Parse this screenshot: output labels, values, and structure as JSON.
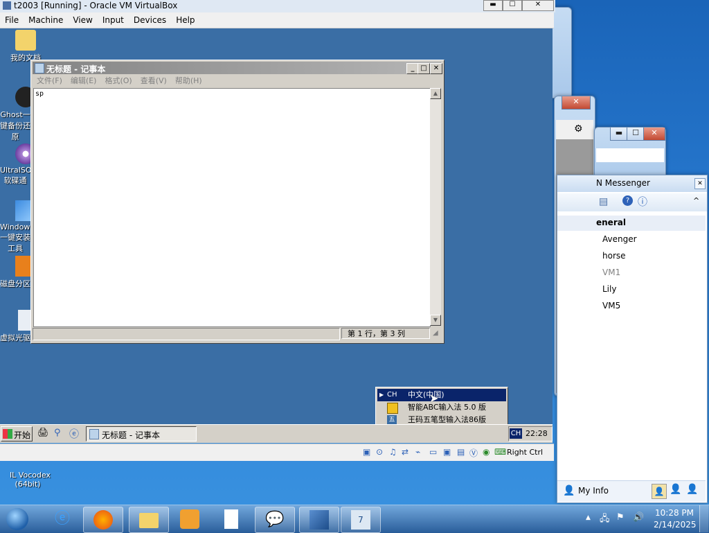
{
  "vbox": {
    "title": "t2003 [Running] - Oracle VM VirtualBox",
    "menu": [
      "File",
      "Machine",
      "View",
      "Input",
      "Devices",
      "Help"
    ],
    "host_key": "Right Ctrl"
  },
  "guest_desktop": {
    "icons": [
      "我的文档",
      "Ghost一键备份还原",
      "UltraISO软碟通",
      "Windows一键安装工具",
      "磁盘分区",
      "虚拟光驱"
    ]
  },
  "notepad": {
    "title": "无标题 - 记事本",
    "menu": [
      "文件(F)",
      "编辑(E)",
      "格式(O)",
      "查看(V)",
      "帮助(H)"
    ],
    "content": "sp",
    "status": "第 1 行，第 3 列"
  },
  "ime_menu": {
    "items": [
      {
        "tag": "CH",
        "label": "中文(中国)"
      },
      {
        "tag": "abc",
        "label": "智能ABC输入法 5.0 版"
      },
      {
        "tag": "wb",
        "label": "王码五笔型输入法86版"
      }
    ]
  },
  "guest_taskbar": {
    "start": "开始",
    "task": "无标题 - 记事本",
    "lang": "CH",
    "clock": "22:28"
  },
  "msn": {
    "title_partial": "N Messenger",
    "group": "eneral",
    "contacts": [
      "Avenger",
      "horse",
      "VM1",
      "Lily",
      "VM5"
    ],
    "my_info": "My Info"
  },
  "host_desktop": {
    "icon_label": "IL Vocodex\n(64bit)"
  },
  "host_taskbar": {
    "time": "10:28 PM",
    "date": "2/14/2025",
    "items": [
      "internet-explorer",
      "firefox",
      "explorer",
      "media-player",
      "document",
      "messenger",
      "virtualbox",
      "vbox-64"
    ]
  },
  "colors": {
    "vbox_bg": "#3a6ea5",
    "title_grey": "#848484",
    "ime_highlight": "#0a246a"
  }
}
